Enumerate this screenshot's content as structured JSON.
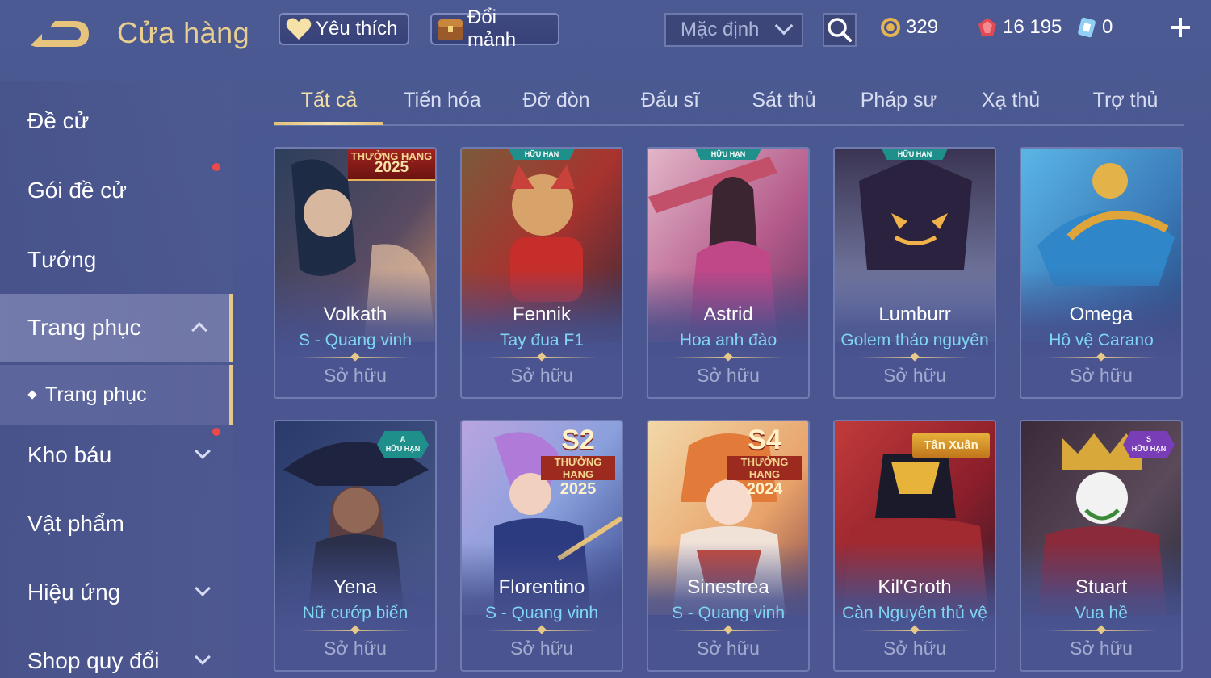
{
  "header": {
    "title": "Cửa hàng",
    "favorites_label": "Yêu thích",
    "exchange_label": "Đổi mảnh",
    "sort_value": "Mặc định"
  },
  "currencies": {
    "gold": "329",
    "gems": "16 195",
    "vouchers": "0"
  },
  "sidebar": {
    "items": [
      {
        "label": "Đề cử"
      },
      {
        "label": "Gói đề cử"
      },
      {
        "label": "Tướng"
      },
      {
        "label": "Trang phục"
      },
      {
        "label": "Trang phục"
      },
      {
        "label": "Kho báu"
      },
      {
        "label": "Vật phẩm"
      },
      {
        "label": "Hiệu ứng"
      },
      {
        "label": "Shop quy đổi"
      }
    ]
  },
  "tabs": [
    "Tất cả",
    "Tiến hóa",
    "Đỡ đòn",
    "Đấu sĩ",
    "Sát thủ",
    "Pháp sư",
    "Xạ thủ",
    "Trợ thủ"
  ],
  "cards": [
    {
      "hero": "Volkath",
      "skin": "S - Quang vinh",
      "status": "Sở hữu",
      "badge": "THƯỞNG HẠNG",
      "badge_year": "2025"
    },
    {
      "hero": "Fennik",
      "skin": "Tay đua F1",
      "status": "Sở hữu",
      "badge": "HỮU HẠN"
    },
    {
      "hero": "Astrid",
      "skin": "Hoa anh đào",
      "status": "Sở hữu",
      "badge": "HỮU HẠN"
    },
    {
      "hero": "Lumburr",
      "skin": "Golem thảo nguyên",
      "status": "Sở hữu",
      "badge": "HỮU HẠN"
    },
    {
      "hero": "Omega",
      "skin": "Hộ vệ Carano",
      "status": "Sở hữu"
    },
    {
      "hero": "Yena",
      "skin": "Nữ cướp biển",
      "status": "Sở hữu",
      "badge": "HỮU HẠN",
      "badge_tier": "A"
    },
    {
      "hero": "Florentino",
      "skin": "S - Quang vinh",
      "status": "Sở hữu",
      "badge_season": "S2",
      "badge": "THƯỞNG HẠNG",
      "badge_year": "2025"
    },
    {
      "hero": "Sinestrea",
      "skin": "S - Quang vinh",
      "status": "Sở hữu",
      "badge_season": "S4",
      "badge": "THƯỞNG HẠNG",
      "badge_year": "2024"
    },
    {
      "hero": "Kil'Groth",
      "skin": "Càn Nguyên thủ vệ",
      "status": "Sở hữu",
      "badge": "Tân Xuân"
    },
    {
      "hero": "Stuart",
      "skin": "Vua hề",
      "status": "Sở hữu",
      "badge": "HỮU HẠN",
      "badge_tier": "S"
    }
  ],
  "colors": {
    "accent_gold": "#e9cf8f",
    "skin_name": "#7fd6f2",
    "notification": "#f04848"
  }
}
